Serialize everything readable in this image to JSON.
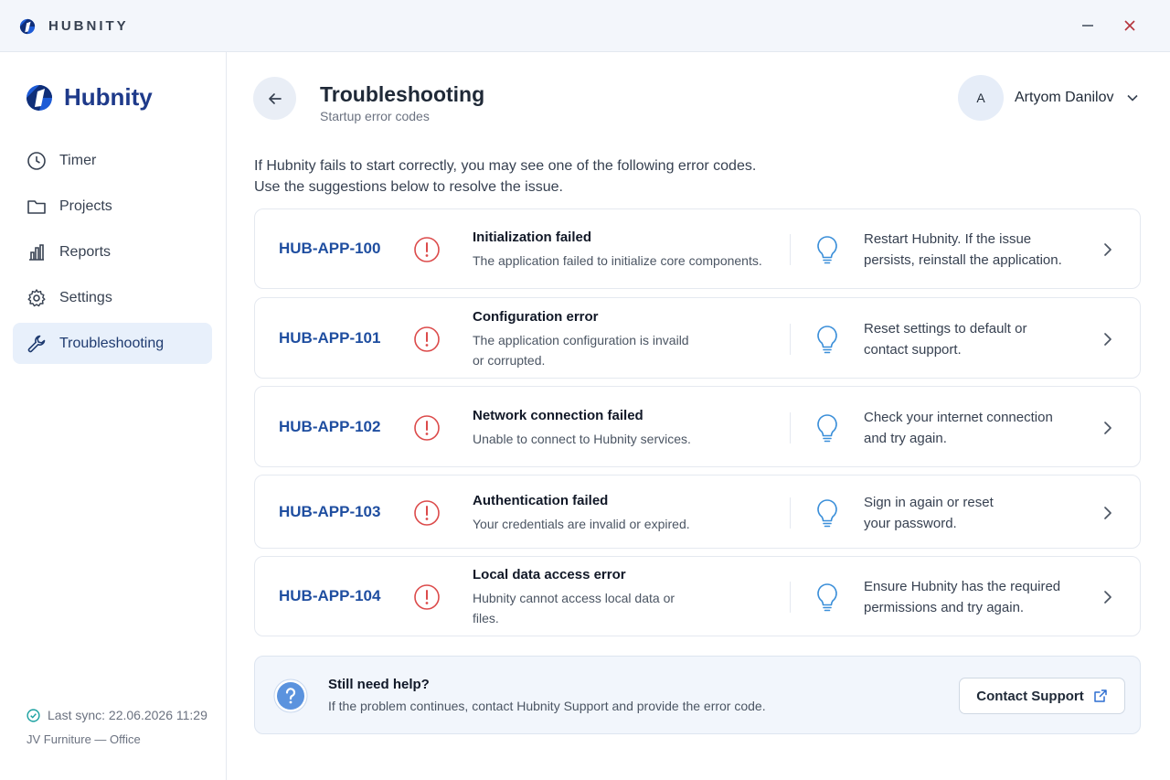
{
  "window": {
    "title": "HUBNITY",
    "min_icon": "minimize-icon",
    "close_icon": "close-icon"
  },
  "sidebar": {
    "brand": "Hubnity",
    "items": [
      {
        "label": "Timer",
        "icon": "clock-icon",
        "active": false
      },
      {
        "label": "Projects",
        "icon": "folder-icon",
        "active": false
      },
      {
        "label": "Reports",
        "icon": "bar-chart-icon",
        "active": false
      },
      {
        "label": "Settings",
        "icon": "gear-icon",
        "active": false
      },
      {
        "label": "Troubleshooting",
        "icon": "wrench-icon",
        "active": true
      }
    ],
    "sync": "Last sync: 22.06.2026 11:29",
    "workspace": "JV Furniture — Office"
  },
  "header": {
    "title": "Troubleshooting",
    "subtitle": "Startup error codes",
    "user_initial": "A",
    "user_name": "Artyom Danilov"
  },
  "intro": {
    "line1": "If Hubnity fails to start correctly, you may see one of the following error codes.",
    "line2": "Use the suggestions below to resolve the issue."
  },
  "errors": [
    {
      "code": "HUB-APP-100",
      "title": "Initialization failed",
      "desc_lines": [
        "The application failed to initialize core components."
      ],
      "sugg_lines": [
        "Restart Hubnity. If the issue",
        "persists, reinstall the application."
      ]
    },
    {
      "code": "HUB-APP-101",
      "title": "Configuration error",
      "desc_lines": [
        "The application configuration is invaild",
        "or corrupted."
      ],
      "sugg_lines": [
        "Reset settings to default or",
        "contact support."
      ]
    },
    {
      "code": "HUB-APP-102",
      "title": "Network connection failed",
      "desc_lines": [
        "Unable to connect to Hubnity services."
      ],
      "sugg_lines": [
        "Check your internet connection",
        "and try again."
      ]
    },
    {
      "code": "HUB-APP-103",
      "title": "Authentication failed",
      "desc_lines": [
        "Your credentials are invalid or expired."
      ],
      "sugg_lines": [
        "Sign in again or reset",
        "your password."
      ]
    },
    {
      "code": "HUB-APP-104",
      "title": "Local data access error",
      "desc_lines": [
        "Hubnity cannot access local data or",
        "files."
      ],
      "sugg_lines": [
        "Ensure Hubnity has the required",
        "permissions and try again."
      ]
    }
  ],
  "help": {
    "title": "Still need help?",
    "text": "If the problem continues, contact Hubnity Support and provide the error code.",
    "button": "Contact Support"
  },
  "colors": {
    "accent": "#1f4ea0",
    "error": "#dc4b4b",
    "hint": "#3b8fd9",
    "active_nav": "#e8f0fb"
  }
}
